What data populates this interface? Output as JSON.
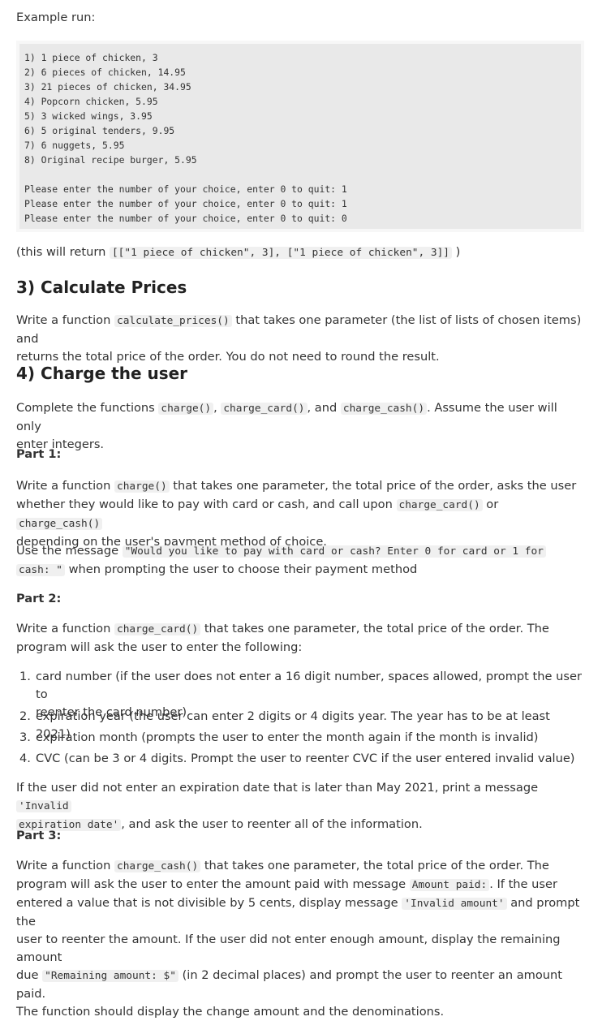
{
  "intro": "Example run:",
  "example_run": {
    "menu": [
      "1) 1 piece of chicken, 3",
      "2) 6 pieces of chicken, 14.95",
      "3) 21 pieces of chicken, 34.95",
      "4) Popcorn chicken, 5.95",
      "5) 3 wicked wings, 3.95",
      "6) 5 original tenders, 9.95",
      "7) 6 nuggets, 5.95",
      "8) Original recipe burger, 5.95"
    ],
    "prompts": [
      "Please enter the number of your choice, enter 0 to quit: 1",
      "Please enter the number of your choice, enter 0 to quit: 1",
      "Please enter the number of your choice, enter 0 to quit: 0"
    ]
  },
  "return_note": {
    "before": "(this will return ",
    "code": "[[\"1 piece of chicken\", 3], [\"1 piece of chicken\", 3]]",
    "after": " )"
  },
  "section3": {
    "title": "3) Calculate Prices",
    "p_before": "Write a function ",
    "p_code": "calculate_prices()",
    "p_after_line1": " that takes one parameter (the list of lists of chosen items) and",
    "p_line2": "returns the total price of the order. You do not need to round the result."
  },
  "section4": {
    "title": "4) Charge the user",
    "intro_before": "Complete the functions ",
    "intro_code1": "charge()",
    "intro_sep1": ", ",
    "intro_code2": "charge_card()",
    "intro_sep2": ", and ",
    "intro_code3": "charge_cash()",
    "intro_after": ". Assume the user will only",
    "intro_line2": "enter integers.",
    "part1": {
      "label": "Part 1:",
      "l1_before": "Write a function ",
      "l1_code": "charge()",
      "l1_after": " that takes one parameter, the total price of the order, asks the user",
      "l2_before": "whether they would like to pay with card or cash, and call upon ",
      "l2_code1": "charge_card()",
      "l2_mid": " or ",
      "l2_code2": "charge_cash()",
      "l3": "depending on the user's payment method of choice.",
      "m1_before": "Use the message ",
      "m1_code": "\"Would you like to pay with card or cash? Enter 0 for card or 1 for",
      "m2_code": "cash: \"",
      "m2_after": " when prompting the user to choose their payment method"
    },
    "part2": {
      "label": "Part 2:",
      "l1_before": "Write a function ",
      "l1_code": "charge_card()",
      "l1_after": " that takes one parameter, the total price of the order. The",
      "l2": "program will ask the user to enter the following:",
      "items": [
        {
          "num": "1.",
          "line1": "card number (if the user does not enter a 16 digit number, spaces allowed, prompt the user to",
          "line2": "reenter the card number)"
        },
        {
          "num": "2.",
          "line1": "expiration year (the user can enter 2 digits or 4 digits year. The year has to be at least 2021)"
        },
        {
          "num": "3.",
          "line1": "expiration month (prompts the user to enter the month again if the month is invalid)"
        },
        {
          "num": "4.",
          "line1": "CVC (can be 3 or 4 digits. Prompt the user to reenter CVC if the user entered invalid value)"
        }
      ],
      "e1_before": "If the user did not enter an expiration date that is later than May 2021, print a message ",
      "e1_code": "'Invalid",
      "e2_code": "expiration date'",
      "e2_after": ", and ask the user to reenter all of the information."
    },
    "part3": {
      "label": "Part 3:",
      "l1_before": "Write a function ",
      "l1_code": "charge_cash()",
      "l1_after": " that takes one parameter, the total price of the order. The",
      "l2_before": "program will ask the user to enter the amount paid with message ",
      "l2_code": "Amount paid:",
      "l2_after": ". If the user",
      "l3_before": "entered a value that is not divisible by 5 cents, display message ",
      "l3_code": "'Invalid amount'",
      "l3_after": " and prompt the",
      "l4": "user to reenter the amount. If the user did not enter enough amount, display the remaining amount",
      "l5_before": "due ",
      "l5_code": "\"Remaining amount: $\"",
      "l5_after": " (in 2 decimal places) and prompt the user to reenter an amount paid.",
      "l6": "The function should display the change amount and the denominations."
    }
  }
}
